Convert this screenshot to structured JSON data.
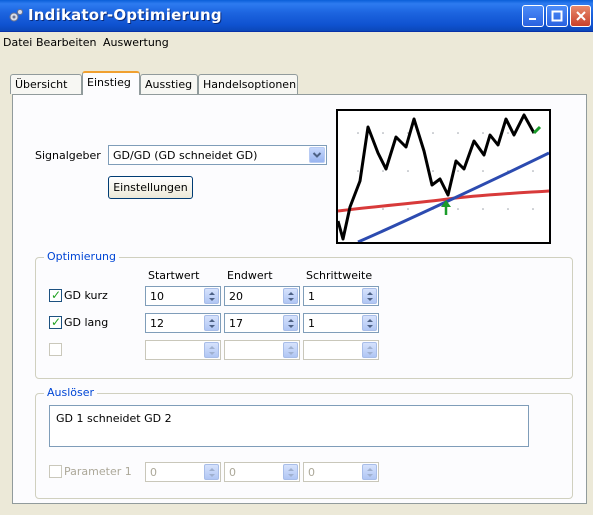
{
  "window": {
    "title": "Indikator-Optimierung"
  },
  "menu": [
    "Datei",
    "Bearbeiten",
    "Auswertung"
  ],
  "tabs": [
    "Übersicht",
    "Einstieg",
    "Ausstieg",
    "Handelsoptionen"
  ],
  "active_tab": "Einstieg",
  "signal": {
    "label": "Signalgeber",
    "value": "GD/GD (GD schneidet GD)",
    "settings_button": "Einstellungen"
  },
  "optimization": {
    "title": "Optimierung",
    "columns": [
      "Startwert",
      "Endwert",
      "Schrittweite"
    ],
    "rows": [
      {
        "checked": true,
        "label": "GD kurz",
        "values": [
          "10",
          "20",
          "1"
        ]
      },
      {
        "checked": true,
        "label": "GD lang",
        "values": [
          "12",
          "17",
          "1"
        ]
      },
      {
        "checked": false,
        "label": "",
        "values": [
          "",
          "",
          ""
        ]
      }
    ]
  },
  "trigger": {
    "title": "Auslöser",
    "text": "GD 1 schneidet GD 2",
    "param_label": "Parameter 1",
    "param_values": [
      "0",
      "0",
      "0"
    ]
  },
  "colors": {
    "price_line": "#000000",
    "long_ma": "#2c4bb0",
    "short_ma": "#d83a3a",
    "signal_arrow": "#1a9c2a"
  }
}
